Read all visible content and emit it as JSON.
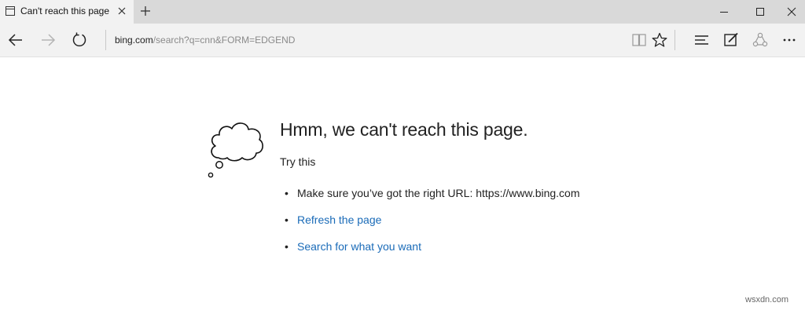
{
  "tab": {
    "title": "Can't reach this page"
  },
  "address": {
    "host": "bing.com",
    "path": "/search?q=cnn&FORM=EDGEND"
  },
  "icons": {
    "tab_page": "page-icon",
    "tab_close": "close-icon",
    "new_tab": "plus-icon",
    "minimize": "minimize-icon",
    "maximize": "maximize-icon",
    "close": "close-icon",
    "back": "back-arrow-icon",
    "forward": "forward-arrow-icon",
    "refresh": "refresh-icon",
    "reading_view": "book-icon",
    "favorite": "star-icon",
    "hub": "hub-icon",
    "web_note": "pen-icon",
    "share": "share-icon",
    "more": "more-icon",
    "illustration": "thought-cloud-icon"
  },
  "error": {
    "headline": "Hmm, we can't reach this page.",
    "try_this": "Try this",
    "suggestions": [
      {
        "text": "Make sure you’ve got the right URL: https://www.bing.com"
      },
      {
        "link": "Refresh the page"
      },
      {
        "link": "Search for what you want"
      }
    ]
  },
  "watermark": "wsxdn.com",
  "colors": {
    "link": "#1a6bb8",
    "tabbar": "#d9d9d9",
    "toolbar": "#f2f2f2"
  }
}
